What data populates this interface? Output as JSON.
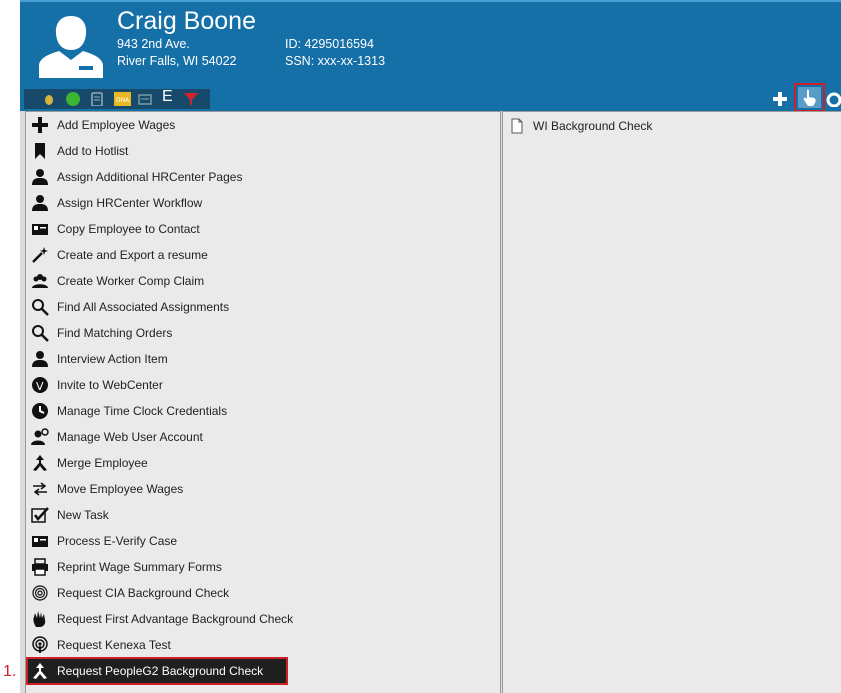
{
  "employee": {
    "name": "Craig Boone",
    "address1": "943 2nd Ave.",
    "address2": "River Falls, WI 54022",
    "id": "ID: 4295016594",
    "ssn": "SSN: xxx-xx-1313"
  },
  "toolbar": {
    "left_icons": [
      "pin-icon",
      "green-status-icon",
      "clipboard-icon",
      "dna-icon",
      "id-card-icon",
      "e-verify-icon",
      "filter-icon"
    ],
    "e_label": "E",
    "right_icons": [
      "add-icon",
      "actions-pointer-icon",
      "refresh-icon"
    ]
  },
  "actions": [
    {
      "label": "Add Employee Wages",
      "icon": "plus-icon"
    },
    {
      "label": "Add to Hotlist",
      "icon": "bookmark-icon"
    },
    {
      "label": "Assign Additional HRCenter Pages",
      "icon": "person-icon"
    },
    {
      "label": "Assign HRCenter Workflow",
      "icon": "person-icon"
    },
    {
      "label": "Copy Employee to Contact",
      "icon": "contact-card-icon"
    },
    {
      "label": "Create and Export a resume",
      "icon": "magic-wand-icon"
    },
    {
      "label": "Create Worker Comp Claim",
      "icon": "group-icon"
    },
    {
      "label": "Find All Associated Assignments",
      "icon": "magnifier-icon"
    },
    {
      "label": "Find Matching Orders",
      "icon": "magnifier-icon"
    },
    {
      "label": "Interview Action Item",
      "icon": "person-icon"
    },
    {
      "label": "Invite to WebCenter",
      "icon": "webcenter-icon"
    },
    {
      "label": "Manage Time Clock Credentials",
      "icon": "timeclock-icon"
    },
    {
      "label": "Manage Web User Account",
      "icon": "web-user-icon"
    },
    {
      "label": "Merge Employee",
      "icon": "merge-icon"
    },
    {
      "label": "Move Employee Wages",
      "icon": "move-arrows-icon"
    },
    {
      "label": "New Task",
      "icon": "checkbox-icon"
    },
    {
      "label": "Process E-Verify Case",
      "icon": "contact-card-icon"
    },
    {
      "label": "Reprint Wage Summary Forms",
      "icon": "printer-icon"
    },
    {
      "label": "Request CIA Background Check",
      "icon": "fingerprint-icon"
    },
    {
      "label": "Request First Advantage Background Check",
      "icon": "handprint-icon"
    },
    {
      "label": "Request Kenexa Test",
      "icon": "podcast-icon"
    },
    {
      "label": "Request PeopleG2 Background Check",
      "icon": "merge-icon"
    }
  ],
  "selected_action": "Request PeopleG2 Background Check",
  "right_panel": {
    "items": [
      {
        "label": "WI Background Check",
        "icon": "document-icon"
      }
    ]
  },
  "annotation": {
    "step": "1."
  },
  "colors": {
    "header": "#1670a8",
    "highlight": "#cc1f2a",
    "selected_row": "#1f1f1f"
  }
}
